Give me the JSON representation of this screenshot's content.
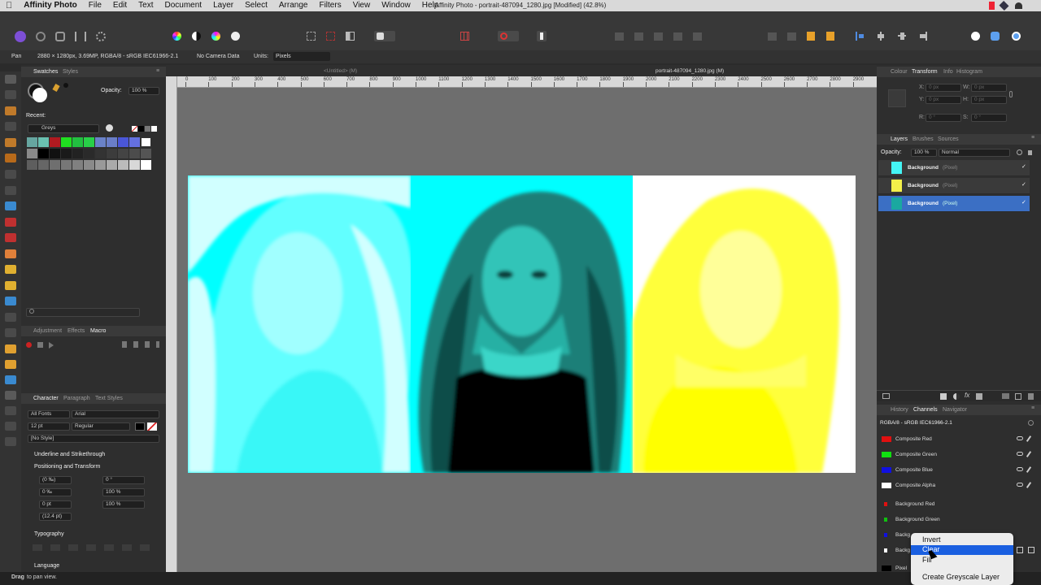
{
  "menubar": {
    "apple": "",
    "app": "Affinity Photo",
    "items": [
      "File",
      "Edit",
      "Text",
      "Document",
      "Layer",
      "Select",
      "Arrange",
      "Filters",
      "View",
      "Window",
      "Help"
    ],
    "title": "Affinity Photo - portrait-487094_1280.jpg [Modified] (42.8%)"
  },
  "context": {
    "tool": "Pan",
    "info": "2880 × 1280px, 3.69MP, RGBA/8 - sRGB IEC61966-2.1",
    "camera": "No Camera Data",
    "units_label": "Units:",
    "units_value": "Pixels"
  },
  "left": {
    "tabs": [
      "Swatches",
      "Styles"
    ],
    "opacity_label": "Opacity:",
    "opacity_value": "100 %",
    "recent_label": "Recent:",
    "palette": "Greys",
    "fx_tabs": [
      "Adjustment",
      "Effects",
      "Macro"
    ],
    "char_tabs": [
      "Character",
      "Paragraph",
      "Text Styles"
    ],
    "font_collection": "All Fonts",
    "font": "Arial",
    "size": "12 pt",
    "style": "Regular",
    "no_style": "[No Style]",
    "sections": [
      "Underline and Strikethrough",
      "Positioning and Transform",
      "Typography",
      "Language"
    ],
    "pos": {
      "a": "(0 ‰)",
      "b": "0 ‰",
      "c": "0 pt",
      "d": "(12.4 pt)",
      "e": "0 °",
      "f": "100 %",
      "g": "100 %"
    }
  },
  "doc": {
    "tab_untitled": "<Untitled> (M)",
    "tab_doc": "portrait-487094_1280.jpg (M)"
  },
  "ruler": [
    "0",
    "100",
    "200",
    "300",
    "400",
    "500",
    "600",
    "700",
    "800",
    "900",
    "1000",
    "1100",
    "1200",
    "1300",
    "1400",
    "1500",
    "1600",
    "1700",
    "1800",
    "1900",
    "2000",
    "2100",
    "2200",
    "2300",
    "2400",
    "2500",
    "2600",
    "2700",
    "2800",
    "2900"
  ],
  "right": {
    "top_tabs": [
      "Colour",
      "Transform",
      "Info",
      "Histogram"
    ],
    "xform": {
      "x": "X:",
      "y": "Y:",
      "w": "W:",
      "h": "H:",
      "r": "R:",
      "s": "S:",
      "xv": "0 px",
      "yv": "0 px",
      "wv": "0 px",
      "hv": "0 px",
      "rv": "0 °",
      "sv": "0 °"
    },
    "layer_tabs": [
      "Layers",
      "Brushes",
      "Sources"
    ],
    "opacity_label": "Opacity:",
    "opacity_value": "100 %",
    "blend": "Normal",
    "layers": [
      {
        "name": "Background",
        "type": "(Pixel)",
        "thumb": "#44f4f4"
      },
      {
        "name": "Background",
        "type": "(Pixel)",
        "thumb": "#f4f04a"
      },
      {
        "name": "Background",
        "type": "(Pixel)",
        "thumb": "#1aa8a0"
      }
    ],
    "bottom_tabs": [
      "History",
      "Channels",
      "Navigator"
    ],
    "profile": "RGBA/8 - sRGB IEC61966-2.1",
    "channels": [
      {
        "name": "Composite Red",
        "color": "#e01010"
      },
      {
        "name": "Composite Green",
        "color": "#10e010"
      },
      {
        "name": "Composite Blue",
        "color": "#1010e0"
      },
      {
        "name": "Composite Alpha",
        "color": "#ffffff"
      },
      {
        "name": "Background Red",
        "color": "#e01010"
      },
      {
        "name": "Background Green",
        "color": "#10c010"
      },
      {
        "name": "Backg",
        "color": "#1010e0"
      },
      {
        "name": "Backg",
        "color": "#ffffff"
      },
      {
        "name": "Pixel",
        "color": "#000000"
      }
    ]
  },
  "contextmenu": {
    "items": [
      "Invert",
      "Clear",
      "Fill",
      "Create Greyscale Layer"
    ],
    "selected": "Clear"
  },
  "status": {
    "bold": "Drag",
    "rest": "to pan view."
  },
  "colors": {
    "cyan": "#00ffff",
    "yellow": "#ffff00",
    "teal": "#0fb5a8",
    "accent": "#3b6fc4",
    "menu_highlight": "#1a5fe0"
  }
}
